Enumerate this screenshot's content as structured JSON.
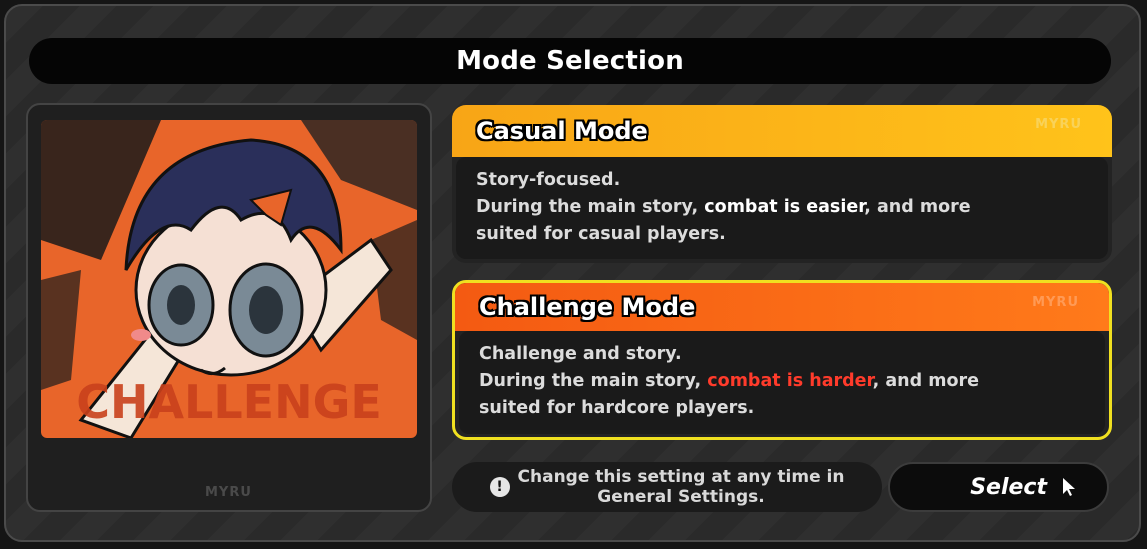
{
  "dialog": {
    "title": "Mode Selection"
  },
  "preview": {
    "art_text": "CHALLENGE",
    "watermark": "MYRU"
  },
  "modes": [
    {
      "name": "Casual Mode",
      "watermark": "MYRU",
      "line1": "Story-focused.",
      "line2_prefix": "During the main story, ",
      "line2_highlight": "combat is easier",
      "line2_suffix": ", and more",
      "line3": "suited for casual players.",
      "selected": false,
      "accent": "#f8a516"
    },
    {
      "name": "Challenge Mode",
      "watermark": "MYRU",
      "line1": "Challenge and story.",
      "line2_prefix": "During the main story, ",
      "line2_highlight": "combat is harder",
      "line2_suffix": ", and more",
      "line3": "suited for hardcore players.",
      "selected": true,
      "accent": "#f45a12",
      "highlight_color": "#ff3b2b",
      "selection_border": "#f0e020"
    }
  ],
  "footer": {
    "info_icon": "!",
    "info_line1": "Change this setting at any time in",
    "info_line2": "General Settings.",
    "select_label": "Select",
    "select_icon": "cursor-arrow-icon"
  }
}
